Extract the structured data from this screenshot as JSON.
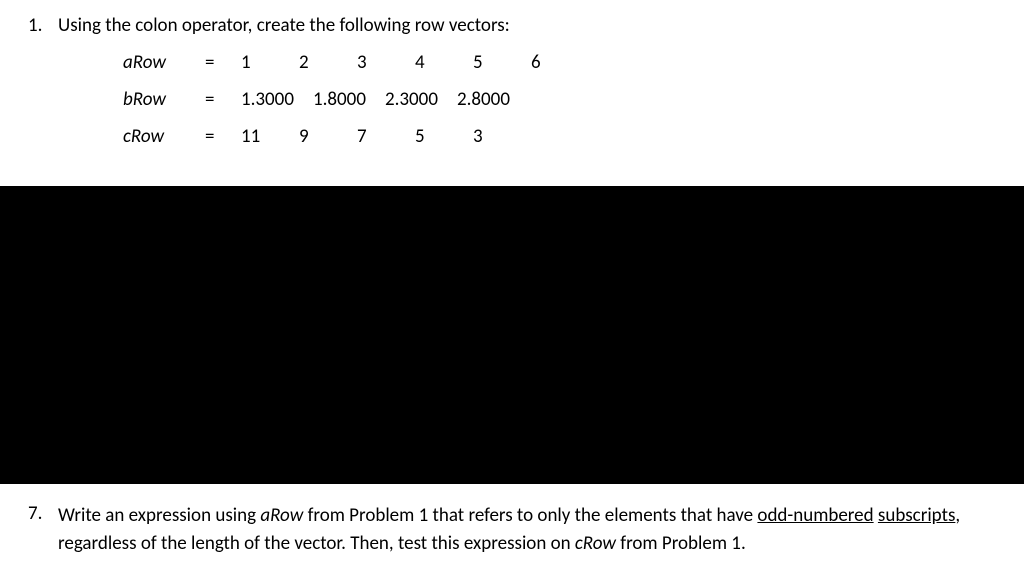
{
  "problem1": {
    "number": "1.",
    "text": "Using the colon operator, create the following row vectors:",
    "rows": {
      "a": {
        "name": "aRow",
        "eq": "=",
        "values": [
          "1",
          "2",
          "3",
          "4",
          "5",
          "6"
        ]
      },
      "b": {
        "name": "bRow",
        "eq": "=",
        "values": [
          "1.3000",
          "1.8000",
          "2.3000",
          "2.8000"
        ]
      },
      "c": {
        "name": "cRow",
        "eq": "=",
        "values": [
          "11",
          "9",
          "7",
          "5",
          "3"
        ]
      }
    }
  },
  "problem7": {
    "number": "7.",
    "parts": {
      "p1": "Write an expression using ",
      "p2": "aRow",
      "p3": " from Problem 1 that refers to only the elements that have ",
      "p4": "odd-numbered",
      "p5": "subscripts",
      "p6": ", regardless of the length of the vector.  Then, test this expression on ",
      "p7": "cRow",
      "p8": " from Problem 1."
    }
  }
}
